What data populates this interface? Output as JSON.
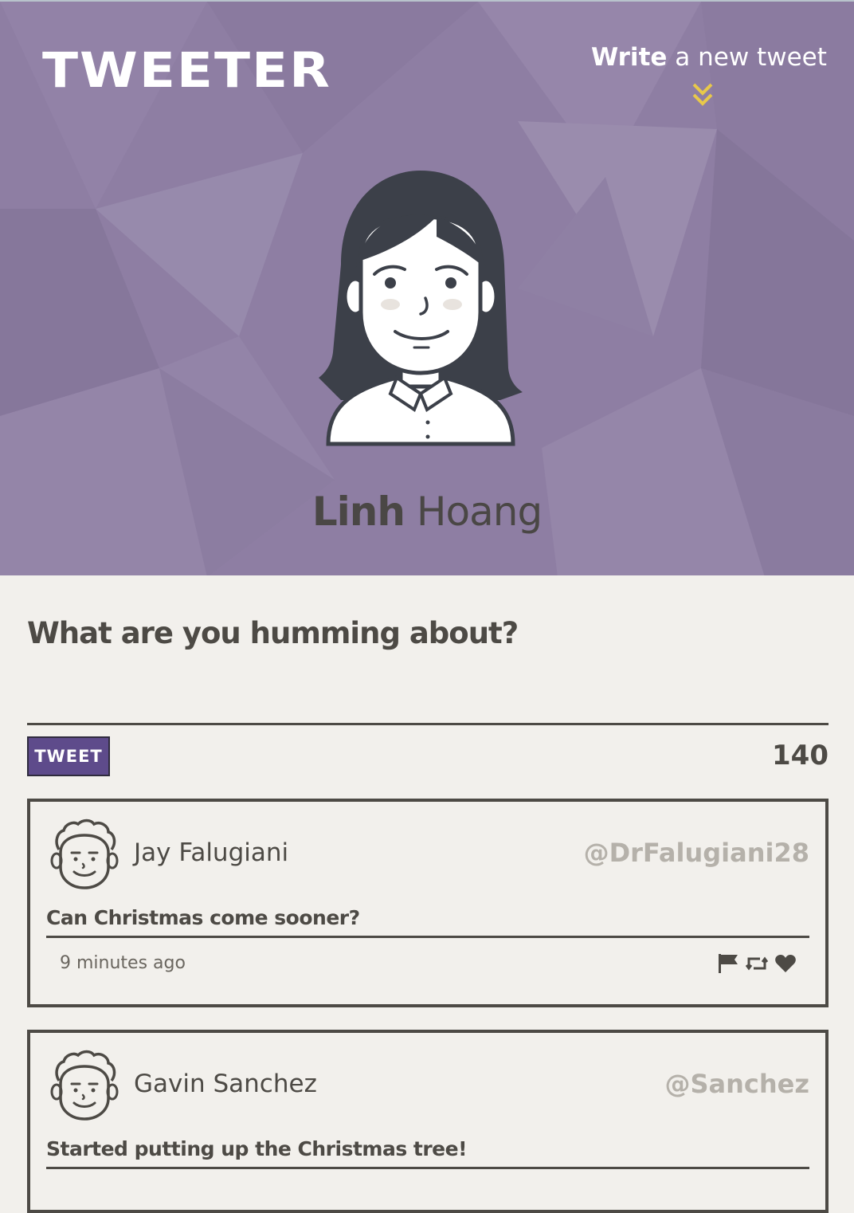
{
  "header": {
    "brand": "TWEETER",
    "compose_toggle": {
      "bold": "Write",
      "rest": " a new tweet",
      "icon": "double-chevron-down-icon"
    }
  },
  "profile": {
    "first_name": "Linh",
    "last_name": "Hoang",
    "avatar": "woman-avatar-illustration"
  },
  "compose": {
    "prompt": "What are you humming about?",
    "value": "",
    "button_label": "TWEET",
    "char_count": "140"
  },
  "tweets": [
    {
      "name": "Jay Falugiani",
      "handle": "@DrFalugiani28",
      "text": "Can Christmas come sooner?",
      "time": "9 minutes ago",
      "avatar": "curly-hair-avatar-icon"
    },
    {
      "name": "Gavin Sanchez",
      "handle": "@Sanchez",
      "text": "Started putting up the Christmas tree!",
      "avatar": "curly-hair-avatar-icon"
    }
  ],
  "colors": {
    "hero_bg": "#8e7ea3",
    "page_bg": "#f2f0ec",
    "text": "#4d4a45",
    "handle": "#b5b1aa",
    "button_bg": "#5e4b8b",
    "chevron": "#e8c84a"
  }
}
